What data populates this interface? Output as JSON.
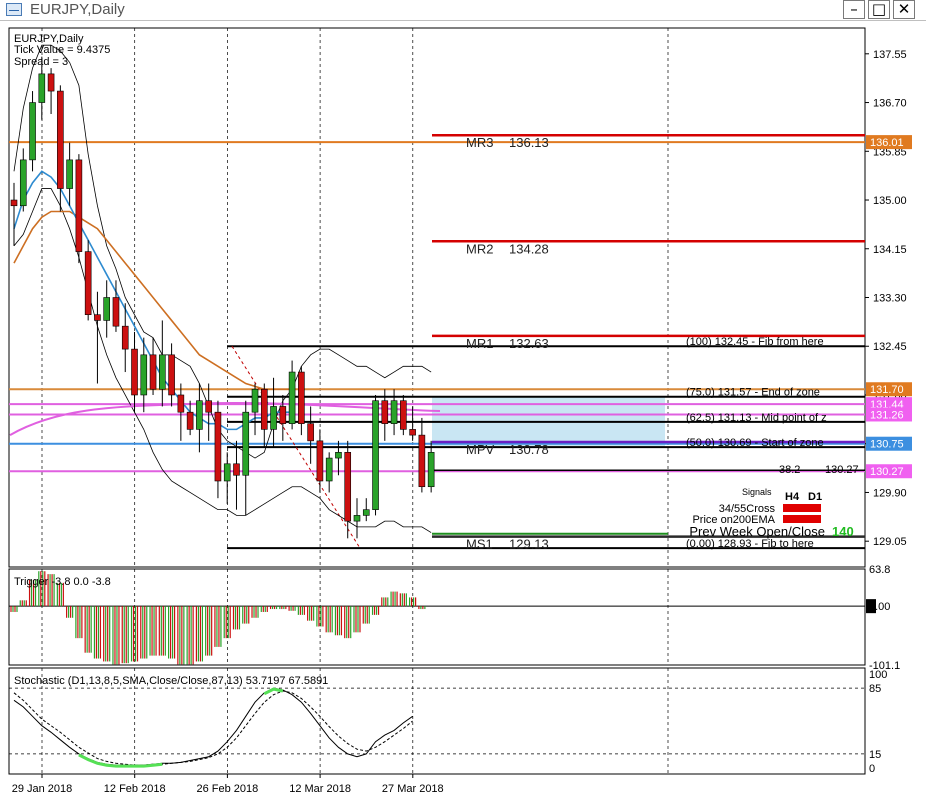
{
  "window": {
    "title": "EURJPY,Daily",
    "buttons": [
      "minimize",
      "restore",
      "close"
    ]
  },
  "chart_data": {
    "type": "candlestick",
    "symbol_label": "EURJPY,Daily",
    "info_lines": [
      "Tick Value = 9.4375",
      "Spread = 3"
    ],
    "price_axis": {
      "min": 128.6,
      "max": 138.0,
      "ticks": [
        "137.55",
        "136.70",
        "135.85",
        "135.00",
        "134.15",
        "133.30",
        "132.45",
        "131.60",
        "130.75",
        "129.90",
        "129.05"
      ]
    },
    "date_labels": [
      {
        "label": "29 Jan 2018",
        "index": 0
      },
      {
        "label": "12 Feb 2018",
        "index": 10
      },
      {
        "label": "26 Feb 2018",
        "index": 20
      },
      {
        "label": "12 Mar 2018",
        "index": 30
      },
      {
        "label": "27 Mar 2018",
        "index": 40
      }
    ],
    "candles": [
      [
        135.0,
        135.3,
        134.2,
        134.9
      ],
      [
        134.9,
        135.9,
        134.8,
        135.7
      ],
      [
        135.7,
        136.9,
        135.5,
        136.7
      ],
      [
        136.7,
        137.5,
        136.4,
        137.2
      ],
      [
        137.2,
        137.3,
        136.5,
        136.9
      ],
      [
        136.9,
        137.0,
        134.8,
        135.2
      ],
      [
        135.2,
        136.0,
        134.9,
        135.7
      ],
      [
        135.7,
        135.8,
        133.9,
        134.1
      ],
      [
        134.1,
        134.3,
        132.9,
        133.0
      ],
      [
        133.0,
        133.4,
        131.8,
        132.9
      ],
      [
        132.9,
        133.6,
        132.6,
        133.3
      ],
      [
        133.3,
        133.6,
        132.7,
        132.8
      ],
      [
        132.8,
        133.2,
        132.0,
        132.4
      ],
      [
        132.4,
        132.7,
        131.3,
        131.6
      ],
      [
        131.6,
        132.6,
        131.3,
        132.3
      ],
      [
        132.3,
        132.6,
        131.6,
        131.7
      ],
      [
        131.7,
        132.9,
        131.4,
        132.3
      ],
      [
        132.3,
        132.5,
        131.4,
        131.6
      ],
      [
        131.6,
        131.8,
        130.8,
        131.3
      ],
      [
        131.3,
        131.5,
        130.9,
        131.0
      ],
      [
        131.0,
        131.8,
        130.6,
        131.5
      ],
      [
        131.5,
        131.8,
        130.8,
        131.3
      ],
      [
        131.3,
        131.5,
        129.8,
        130.1
      ],
      [
        130.1,
        130.6,
        129.7,
        130.4
      ],
      [
        130.4,
        130.8,
        129.6,
        130.2
      ],
      [
        130.2,
        131.5,
        129.5,
        131.3
      ],
      [
        131.3,
        131.8,
        130.9,
        131.7
      ],
      [
        131.7,
        131.8,
        130.7,
        131.0
      ],
      [
        131.0,
        131.9,
        130.7,
        131.4
      ],
      [
        131.4,
        131.6,
        130.8,
        131.1
      ],
      [
        131.1,
        132.2,
        131.0,
        132.0
      ],
      [
        132.0,
        132.1,
        130.9,
        131.1
      ],
      [
        131.1,
        131.4,
        130.4,
        130.8
      ],
      [
        130.8,
        131.0,
        129.9,
        130.1
      ],
      [
        130.1,
        130.6,
        129.9,
        130.5
      ],
      [
        130.5,
        130.8,
        130.2,
        130.6
      ],
      [
        130.6,
        130.8,
        129.1,
        129.4
      ],
      [
        129.4,
        129.8,
        129.1,
        129.5
      ],
      [
        129.5,
        129.8,
        129.4,
        129.6
      ],
      [
        129.6,
        131.6,
        129.5,
        131.5
      ],
      [
        131.5,
        131.7,
        130.8,
        131.1
      ],
      [
        131.1,
        131.7,
        130.9,
        131.5
      ],
      [
        131.5,
        131.6,
        130.9,
        131.0
      ],
      [
        131.0,
        131.4,
        130.8,
        130.9
      ],
      [
        130.9,
        131.2,
        129.9,
        130.0
      ],
      [
        130.0,
        130.8,
        129.9,
        130.6
      ]
    ],
    "moving_averages": [
      {
        "color": "#cd6f22",
        "values": [
          133.9,
          134.2,
          134.5,
          134.7,
          134.8,
          134.8,
          134.8,
          134.7,
          134.6,
          134.5,
          134.3,
          134.1,
          133.9,
          133.7,
          133.5,
          133.3,
          133.1,
          132.9,
          132.7,
          132.5,
          132.3,
          132.2,
          132.1,
          132.0,
          131.9,
          131.8,
          131.75,
          131.7,
          131.7,
          131.7,
          131.7
        ]
      },
      {
        "color": "#2e8bd0",
        "values": [
          134.5,
          135.0,
          135.3,
          135.5,
          135.4,
          135.2,
          134.9,
          134.6,
          134.3,
          134.0,
          133.7,
          133.4,
          133.1,
          132.8,
          132.5,
          132.2,
          131.9,
          131.7,
          131.5,
          131.3,
          131.2,
          131.1,
          131.1,
          131.0,
          131.0,
          131.1,
          131.2,
          131.2,
          131.3,
          131.3,
          131.3
        ]
      }
    ],
    "envelope_upper": [
      135.5,
      136.6,
      137.3,
      137.7,
      137.7,
      137.6,
      137.4,
      137.0,
      135.8,
      134.9,
      134.2,
      133.8,
      133.3,
      133.0,
      132.7,
      132.6,
      132.3,
      132.3,
      132.2,
      132.1,
      131.8,
      131.4,
      131.0,
      130.8,
      130.7,
      130.6,
      130.5,
      130.6,
      131.1,
      131.5,
      131.7,
      132.1,
      132.3,
      132.4,
      132.4,
      132.3,
      132.2,
      132.1,
      132.1,
      132.0,
      131.9,
      132.0,
      132.1,
      132.1,
      132.1,
      132.0
    ],
    "envelope_lower": [
      134.2,
      134.4,
      134.8,
      135.2,
      135.2,
      134.9,
      134.5,
      134.0,
      133.4,
      132.8,
      132.3,
      131.9,
      131.6,
      131.3,
      131.0,
      130.6,
      130.3,
      130.1,
      130.0,
      129.9,
      129.8,
      129.7,
      129.6,
      129.6,
      129.5,
      129.5,
      129.6,
      129.7,
      129.8,
      129.9,
      130.0,
      130.0,
      129.9,
      129.8,
      129.6,
      129.5,
      129.4,
      129.3,
      129.3,
      129.3,
      129.4,
      129.4,
      129.3,
      129.3,
      129.3,
      129.2
    ],
    "levels": [
      {
        "label": "MR3",
        "value": "136.13",
        "price": 136.13,
        "color": "#d40000"
      },
      {
        "label": "MR2",
        "value": "134.28",
        "price": 134.28,
        "color": "#d40000"
      },
      {
        "label": "MR1",
        "value": "132.63",
        "price": 132.63,
        "color": "#d40000"
      },
      {
        "label": "MPV",
        "value": "130.78",
        "price": 130.78,
        "color": "#6a1fc4"
      },
      {
        "label": "MS1",
        "value": "129.13",
        "price": 129.13,
        "color": "#2a2a2a"
      }
    ],
    "fib_levels": [
      {
        "text": "(100)  132.45  - Fib from here",
        "price": 132.45
      },
      {
        "text": "(75.0)  131.57  - End of zone",
        "price": 131.57
      },
      {
        "text": "(62.5)  131.13  - Mid point of z",
        "price": 131.13
      },
      {
        "text": "(50.0)  130.69  - Start of zone",
        "price": 130.69
      },
      {
        "text": "(0.00)  128.93  - Fib to here",
        "price": 128.93
      }
    ],
    "fib_382": {
      "label": "38.2",
      "value": "130.27",
      "price": 130.27
    },
    "horizontal_lines": [
      {
        "price": 136.01,
        "color": "#e07a20"
      },
      {
        "price": 131.7,
        "color": "#d98a3a"
      },
      {
        "price": 131.44,
        "color": "#e060e0"
      },
      {
        "price": 131.26,
        "color": "#e060e0"
      },
      {
        "price": 130.75,
        "color": "#3c8fe0"
      },
      {
        "price": 130.27,
        "color": "#e060e0"
      }
    ],
    "price_tags": [
      {
        "value": "136.01",
        "price": 136.01,
        "color": "#e07a20"
      },
      {
        "value": "131.70",
        "price": 131.7,
        "color": "#e07a20"
      },
      {
        "value": "131.44",
        "price": 131.44,
        "color": "#f060f0"
      },
      {
        "value": "131.26",
        "price": 131.26,
        "color": "#f060f0"
      },
      {
        "value": "130.75",
        "price": 130.75,
        "color": "#3c8fe0"
      },
      {
        "value": "130.27",
        "price": 130.27,
        "color": "#f060f0"
      }
    ],
    "signals": {
      "title": "Signals",
      "columns": [
        "H4",
        "D1"
      ],
      "rows": [
        "34/55Cross",
        "Price on200EMA"
      ],
      "prev_week_label": "Prev Week Open/Close",
      "prev_week_value": "140"
    },
    "trigger": {
      "title": "Trigger -3.8 0.0 -3.8",
      "axis_labels": [
        "63.8",
        "0.00",
        "-101.1"
      ],
      "range": [
        -101.1,
        63.8
      ],
      "values": [
        -10,
        10,
        45,
        60,
        55,
        40,
        -20,
        -55,
        -80,
        -90,
        -95,
        -100,
        -98,
        -95,
        -90,
        -85,
        -85,
        -90,
        -100,
        -100,
        -95,
        -85,
        -70,
        -55,
        -40,
        -30,
        -20,
        -10,
        -5,
        -5,
        -8,
        -15,
        -25,
        -35,
        -45,
        -50,
        -55,
        -45,
        -30,
        -15,
        15,
        25,
        22,
        15,
        -5,
        0
      ]
    },
    "stochastic": {
      "title": "Stochastic (D1,13,8,5,SMA,Close/Close,87,13) 53.7197 67.5891",
      "axis_labels": [
        "100",
        "85",
        "15",
        "0"
      ],
      "main": [
        72,
        65,
        55,
        45,
        38,
        30,
        22,
        15,
        10,
        6,
        4,
        3,
        3,
        3,
        3,
        4,
        5,
        5,
        6,
        8,
        10,
        12,
        18,
        28,
        40,
        55,
        70,
        80,
        85,
        83,
        78,
        70,
        58,
        45,
        32,
        22,
        15,
        12,
        15,
        28,
        35,
        40,
        48,
        55
      ],
      "signal": [
        80,
        72,
        62,
        52,
        45,
        38,
        30,
        22,
        16,
        10,
        7,
        5,
        4,
        3,
        3,
        4,
        4,
        5,
        6,
        7,
        9,
        11,
        15,
        22,
        32,
        45,
        58,
        70,
        78,
        82,
        80,
        74,
        65,
        55,
        44,
        34,
        26,
        20,
        18,
        22,
        28,
        35,
        42,
        50
      ],
      "oversold_markers": [
        [
          7,
          16
        ],
        [
          27,
          29
        ]
      ]
    }
  }
}
